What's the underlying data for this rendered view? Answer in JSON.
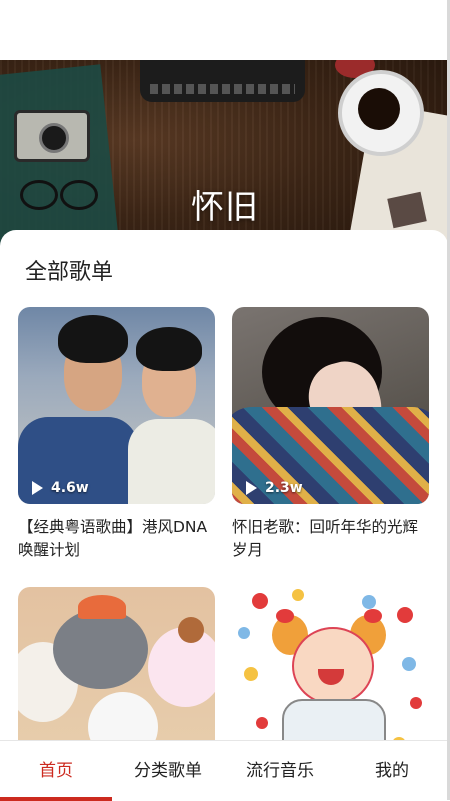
{
  "banner": {
    "title": "怀旧"
  },
  "section": {
    "title": "全部歌单"
  },
  "playlists": [
    {
      "title": "【经典粤语歌曲】港风DNA唤醒计划",
      "play_count": "4.6w",
      "cover": "two-men-portrait"
    },
    {
      "title": "怀旧老歌：回听年华的光辉岁月",
      "play_count": "2.3w",
      "cover": "woman-with-blanket"
    },
    {
      "title": "",
      "play_count": "",
      "cover": "cartoon-wolf-and-sheep"
    },
    {
      "title": "",
      "play_count": "",
      "cover": "cartoon-girl-with-dots"
    }
  ],
  "nav": {
    "tabs": [
      {
        "label": "首页",
        "active": true
      },
      {
        "label": "分类歌单",
        "active": false
      },
      {
        "label": "流行音乐",
        "active": false
      },
      {
        "label": "我的",
        "active": false
      }
    ]
  },
  "colors": {
    "accent": "#cc2a1f",
    "text": "#222222",
    "background": "#ffffff"
  }
}
